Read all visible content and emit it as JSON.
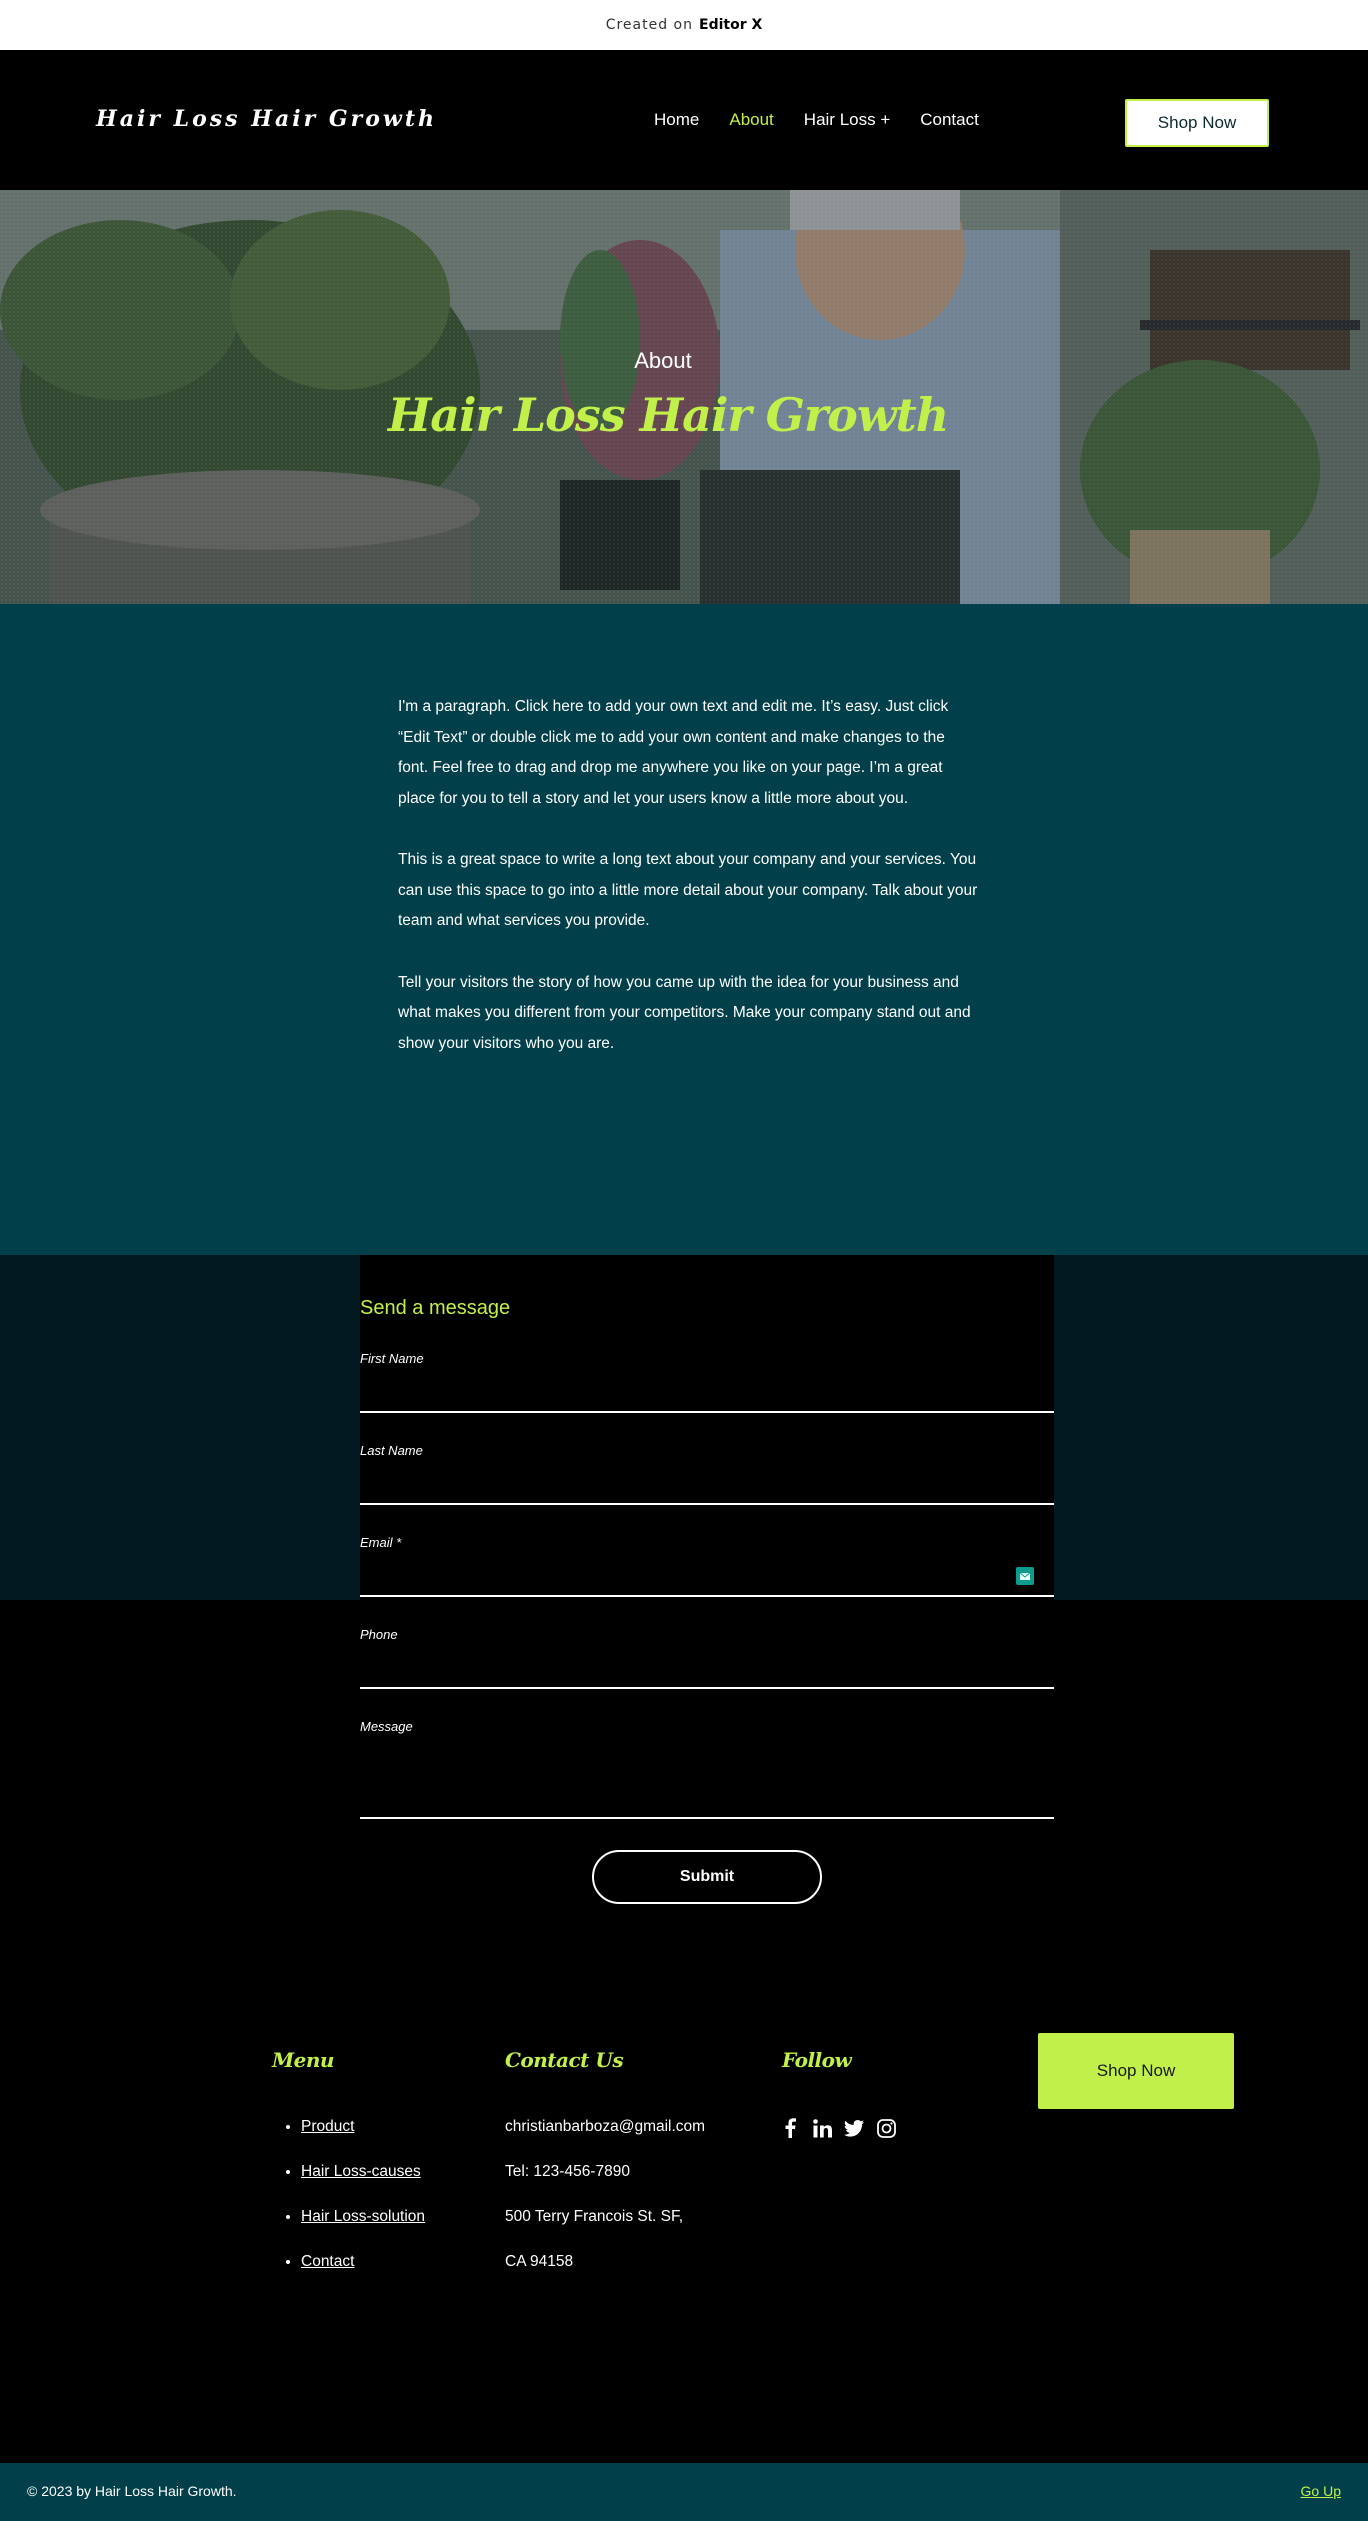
{
  "topbar": {
    "created": "Created on",
    "editor": "Editor X"
  },
  "header": {
    "logo": "Hair Loss Hair Growth",
    "nav": [
      "Home",
      "About",
      "Hair Loss +",
      "Contact"
    ],
    "active_nav": "About",
    "shop_button": "Shop Now"
  },
  "hero": {
    "subtitle": "About",
    "title": "Hair Loss Hair Growth"
  },
  "about": {
    "paragraphs": [
      "I'm a paragraph. Click here to add your own text and edit me. It’s easy. Just click “Edit Text” or double click me to add your own content and make changes to the font. Feel free to drag and drop me anywhere you like on your page. I’m a great place for you to tell a story and let your users know a little more about you.",
      "This is a great space to write a long text about your company and your services. You can use this space to go into a little more detail about your company. Talk about your team and what services you provide.",
      "Tell your visitors the story of how you came up with the idea for your business and what makes you different from your competitors. Make your company stand out and show your visitors who you are."
    ]
  },
  "form": {
    "title": "Send a  message",
    "fields": {
      "first_name": {
        "label": "First Name",
        "value": ""
      },
      "last_name": {
        "label": "Last Name",
        "value": ""
      },
      "email": {
        "label": "Email *",
        "value": ""
      },
      "phone": {
        "label": "Phone",
        "value": ""
      },
      "message": {
        "label": "Message",
        "value": ""
      }
    },
    "submit": "Submit"
  },
  "footer": {
    "menu_title": "Menu",
    "menu": [
      "Product",
      "Hair Loss-causes",
      "Hair Loss-solution",
      "Contact"
    ],
    "contact_title": "Contact Us",
    "contact": [
      "christianbarboza@gmail.com",
      "Tel: 123-456-7890",
      "500 Terry Francois St. SF,",
      "CA 94158"
    ],
    "follow_title": "Follow",
    "social_icons": [
      "facebook-icon",
      "linkedin-icon",
      "twitter-icon",
      "instagram-icon"
    ],
    "shop_button": "Shop Now",
    "copyright": "© 2023 by Hair Loss Hair Growth.",
    "go_up": "Go Up"
  },
  "colors": {
    "accent": "#c2f04a",
    "teal": "#01404a",
    "dark": "#021a1f"
  }
}
